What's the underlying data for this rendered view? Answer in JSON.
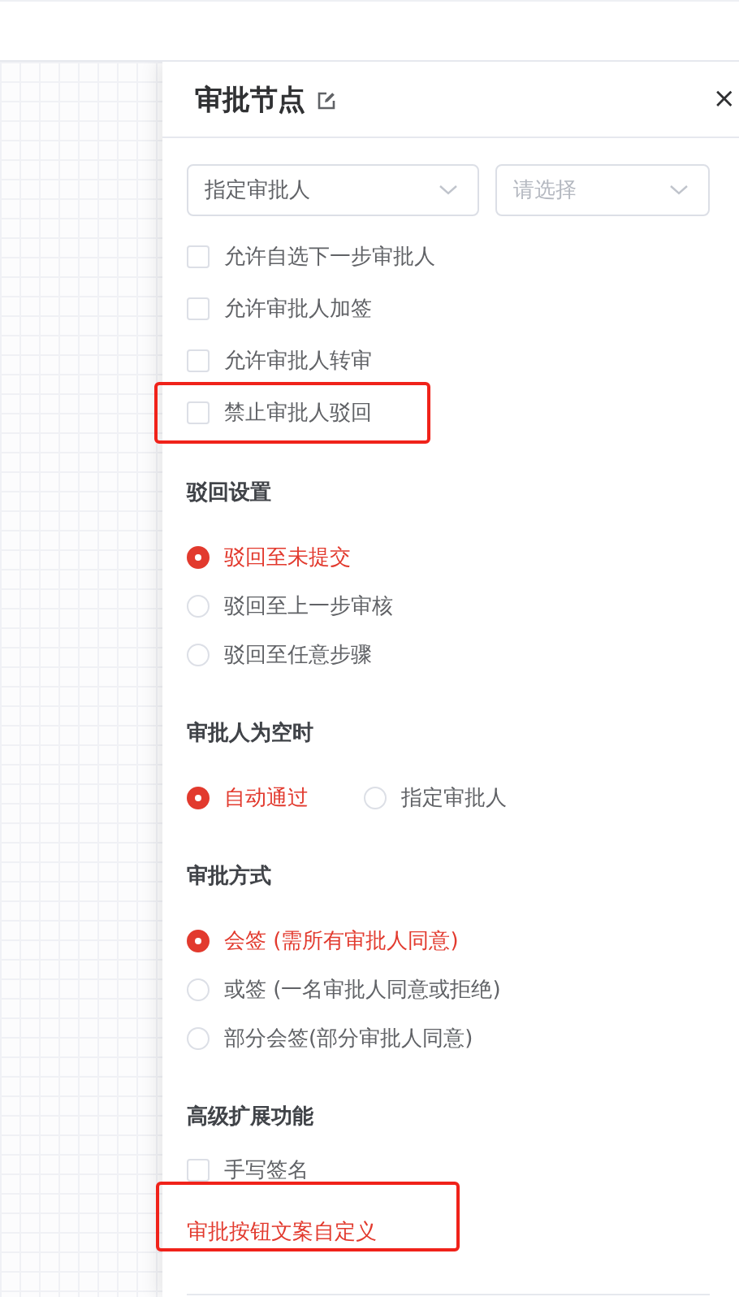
{
  "panel": {
    "title": "审批节点",
    "close": "×",
    "approver_type": {
      "value": "指定审批人"
    },
    "approver_select": {
      "placeholder": "请选择"
    },
    "options": [
      {
        "label": "允许自选下一步审批人",
        "checked": false,
        "highlighted": false
      },
      {
        "label": "允许审批人加签",
        "checked": false,
        "highlighted": false
      },
      {
        "label": "允许审批人转审",
        "checked": false,
        "highlighted": false
      },
      {
        "label": "禁止审批人驳回",
        "checked": false,
        "highlighted": true
      }
    ],
    "sections": [
      {
        "title": "驳回设置",
        "kind": "radio",
        "inline": false,
        "items": [
          {
            "label": "驳回至未提交",
            "selected": true
          },
          {
            "label": "驳回至上一步审核",
            "selected": false
          },
          {
            "label": "驳回至任意步骤",
            "selected": false
          }
        ]
      },
      {
        "title": "审批人为空时",
        "kind": "radio",
        "inline": true,
        "items": [
          {
            "label": "自动通过",
            "selected": true
          },
          {
            "label": "指定审批人",
            "selected": false
          }
        ]
      },
      {
        "title": "审批方式",
        "kind": "radio",
        "inline": false,
        "items": [
          {
            "label": "会签 (需所有审批人同意)",
            "selected": true
          },
          {
            "label": "或签 (一名审批人同意或拒绝)",
            "selected": false
          },
          {
            "label": "部分会签(部分审批人同意)",
            "selected": false
          }
        ]
      },
      {
        "title": "高级扩展功能",
        "kind": "checkbox",
        "inline": false,
        "items": [
          {
            "label": "手写签名",
            "checked": false
          }
        ]
      }
    ],
    "custom_link": {
      "label": "审批按钮文案自定义",
      "highlighted": true
    }
  }
}
